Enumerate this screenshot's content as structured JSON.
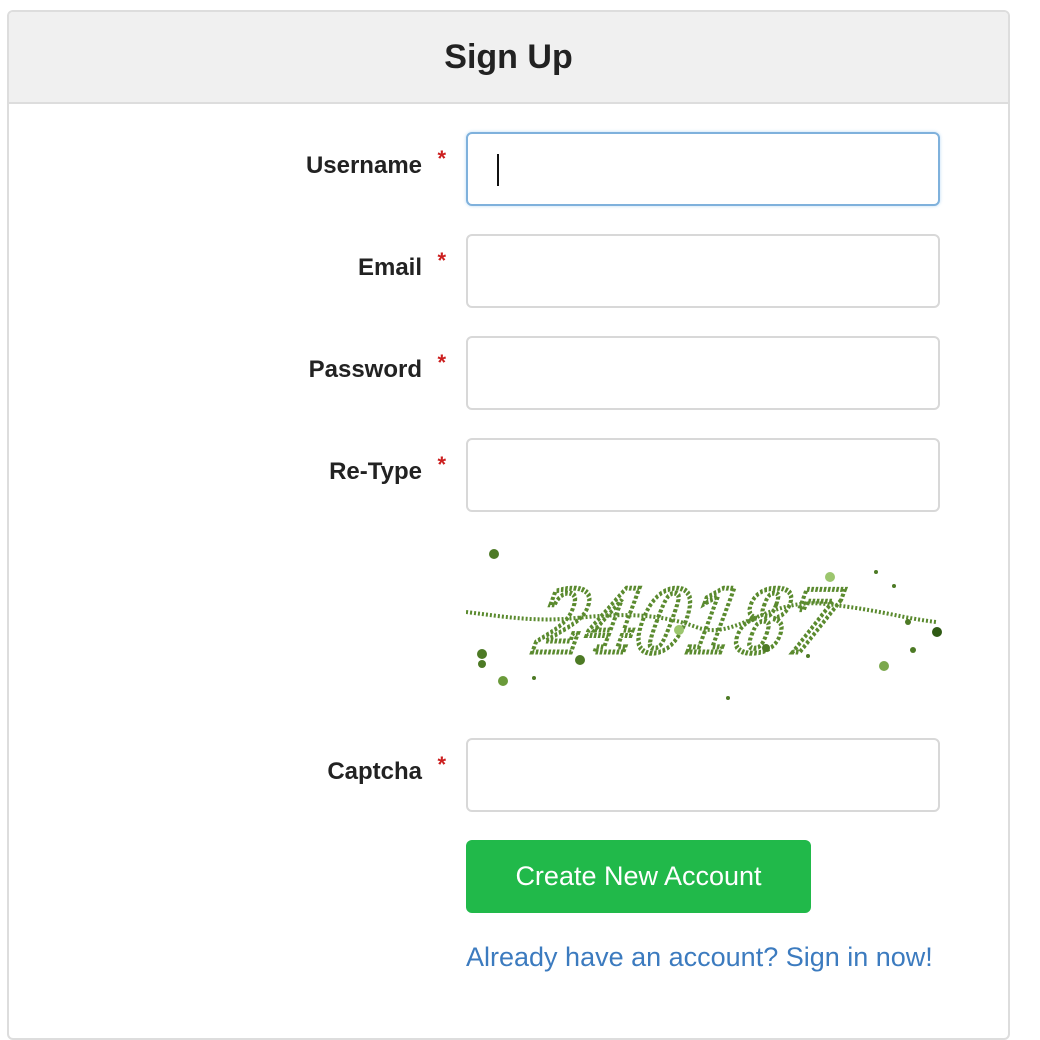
{
  "header": {
    "title": "Sign Up"
  },
  "form": {
    "required_marker": "*",
    "fields": [
      {
        "label": "Username",
        "value": "",
        "placeholder": ""
      },
      {
        "label": "Email",
        "value": "",
        "placeholder": ""
      },
      {
        "label": "Password",
        "value": "",
        "placeholder": ""
      },
      {
        "label": "Re-Type",
        "value": "",
        "placeholder": ""
      },
      {
        "label": "Captcha",
        "value": "",
        "placeholder": ""
      }
    ],
    "captcha_text": "240187",
    "submit_label": "Create New Account",
    "signin_link": "Already have an account? Sign in now!"
  },
  "colors": {
    "required": "#cc1f1f",
    "button": "#21b94a",
    "link": "#3c7bbf",
    "focus_border": "#7fb1dc",
    "captcha_ink": "#5a8a2e"
  }
}
